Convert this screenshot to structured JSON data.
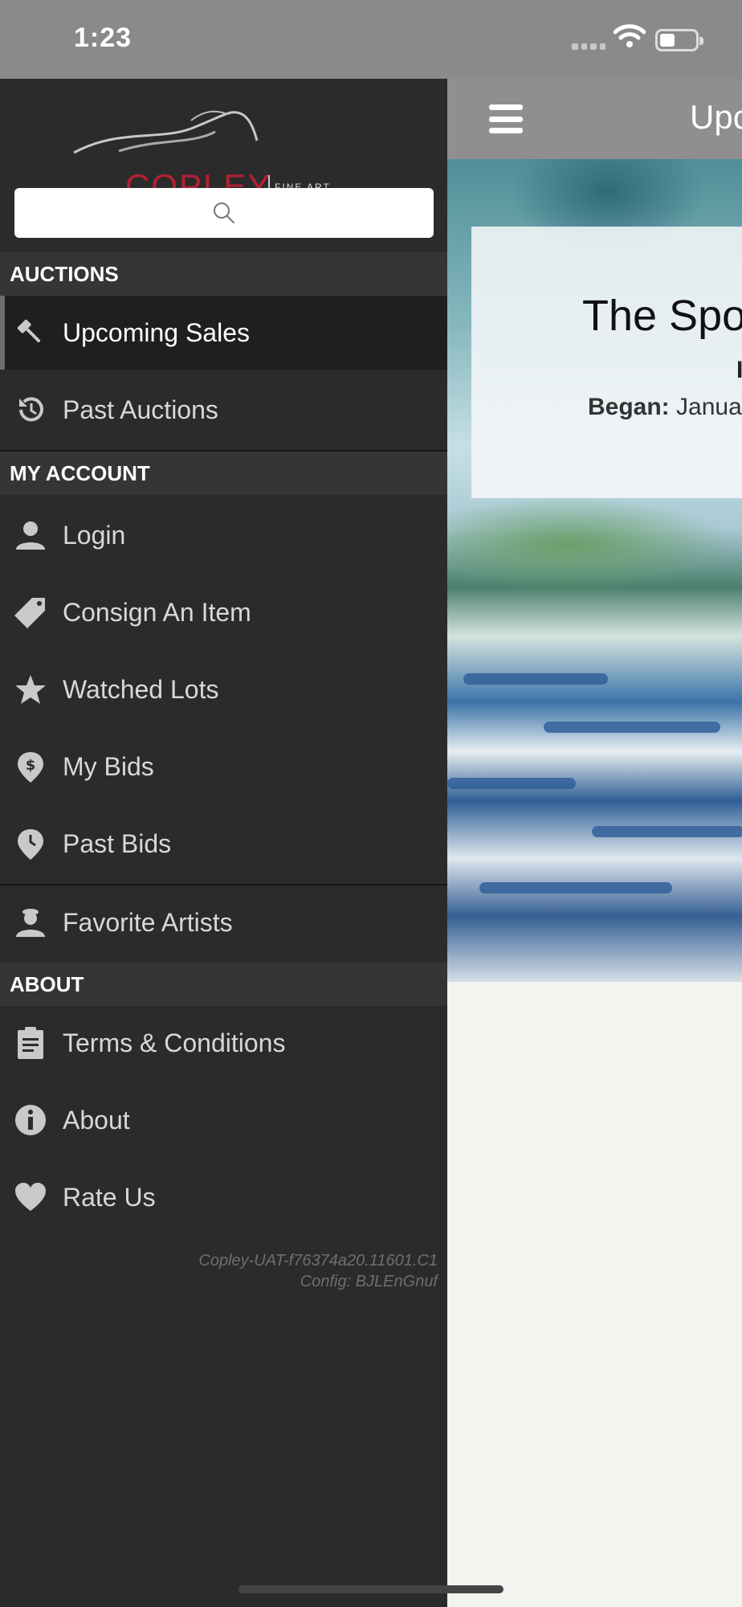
{
  "status_bar": {
    "time": "1:23"
  },
  "main": {
    "title": "Upc",
    "card": {
      "title": "The Spo",
      "subtitle": "I",
      "began_label": "Began:",
      "began_value": " Janua"
    }
  },
  "drawer": {
    "logo": {
      "brand": "COPLEY",
      "tagline": "FINE ART AUCTIONS"
    },
    "search": {
      "placeholder": ""
    },
    "sections": {
      "auctions": "AUCTIONS",
      "my_account": "MY ACCOUNT",
      "about": "ABOUT"
    },
    "items": {
      "upcoming_sales": "Upcoming Sales",
      "past_auctions": "Past Auctions",
      "login": "Login",
      "consign_item": "Consign An Item",
      "watched_lots": "Watched Lots",
      "my_bids": "My Bids",
      "past_bids": "Past Bids",
      "favorite_artists": "Favorite Artists",
      "terms": "Terms & Conditions",
      "about": "About",
      "rate_us": "Rate Us"
    },
    "version": {
      "build": "Copley-UAT-f76374a20.11601.C1",
      "config": "Config: BJLEnGnuf"
    }
  },
  "icons": [
    "gavel-icon",
    "history-icon",
    "user-icon",
    "tag-icon",
    "star-icon",
    "dollar-pin-icon",
    "clock-pin-icon",
    "artist-icon",
    "clipboard-icon",
    "info-icon",
    "heart-icon",
    "search-icon",
    "menu-icon"
  ]
}
